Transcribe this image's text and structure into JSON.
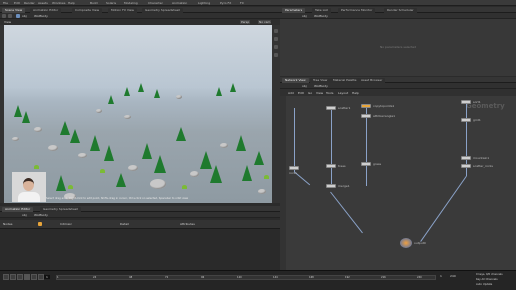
{
  "menubar": {
    "items": [
      "File",
      "Edit",
      "Render",
      "Assets",
      "Windows",
      "Help",
      "Build",
      "Solaris",
      "Modeling",
      "Character",
      "Animation",
      "Lighting",
      "Pyro FX",
      "FX"
    ]
  },
  "viewer": {
    "tabs": [
      "Scene View",
      "Animation Editor",
      "Composite View",
      "Motion FX View",
      "Geometry Spreadsheet"
    ],
    "path": "obj",
    "path_node": "Wolfbody",
    "title": "View",
    "camera_btn": "Persp",
    "cam_label": "No cam",
    "status_hint": "Select drag area, Right-click to edit point, Shift+drag in cursor, Ctrl+click on selected, Spacebar to orbit view"
  },
  "right_top": {
    "tabs": [
      "Parameters",
      "Take List",
      "Performance Monitor",
      "Render Scheduler",
      "Network"
    ],
    "path": "obj",
    "path_node": "Wolfbody",
    "empty_text": "No parameters selected"
  },
  "network": {
    "tabs": [
      "Network View",
      "Tree View",
      "Material Palette",
      "Asset Browser"
    ],
    "path": "obj",
    "path_node": "Wolfbody",
    "menu": [
      "Add",
      "Edit",
      "Go",
      "View",
      "Tools",
      "Layout",
      "Help"
    ],
    "watermark": "Geometry",
    "nodes": [
      {
        "label": "scatter1",
        "orange": false
      },
      {
        "label": "copytopoints1",
        "orange": true
      },
      {
        "label": "attribwrangle1",
        "orange": false
      },
      {
        "label": "sort1",
        "orange": false
      },
      {
        "label": "merge1",
        "orange": false
      },
      {
        "label": "grid1",
        "orange": false
      },
      {
        "label": "mountain1",
        "orange": false
      },
      {
        "label": "rocks",
        "orange": false
      },
      {
        "label": "trees",
        "orange": false
      },
      {
        "label": "grass",
        "orange": false
      },
      {
        "label": "scatter_rocks",
        "orange": false
      },
      {
        "label": "scatter_trees",
        "orange": false
      },
      {
        "label": "output0",
        "orange": false
      }
    ]
  },
  "lower_left": {
    "tabs": [
      "Animation Editor",
      "Geometry Spreadsheet"
    ],
    "path": "obj",
    "path_node": "Wolfbody",
    "row_label": "Nodes",
    "fields": [
      "Intrinsic",
      "Detail",
      "Attributes"
    ]
  },
  "timeline": {
    "frame": "1",
    "start": "1",
    "end": "240",
    "ticks": [
      "1",
      "24",
      "48",
      "72",
      "96",
      "120",
      "144",
      "168",
      "192",
      "216",
      "240"
    ],
    "right_info": "0 keys, 0/0 channels",
    "right_info2": "Key All Channels",
    "auto_update": "Auto Update"
  },
  "colors": {
    "accent": "#e8a53a",
    "tree_green": "#1f7a2e",
    "sky": "#cfd7df"
  }
}
